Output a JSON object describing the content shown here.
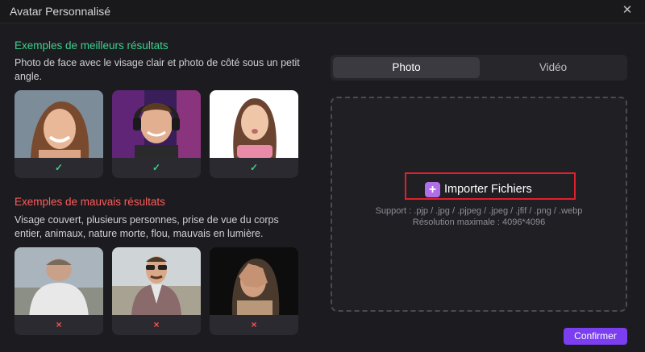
{
  "window": {
    "title": "Avatar Personnalisé"
  },
  "good": {
    "heading": "Exemples de meilleurs résultats",
    "description": "Photo de face avec le visage clair et photo de côté sous un petit angle.",
    "mark": "✓"
  },
  "bad": {
    "heading": "Exemples de mauvais résultats",
    "description": "Visage couvert, plusieurs personnes, prise de vue du corps entier, animaux, nature morte, flou, mauvais en lumière.",
    "mark": "×"
  },
  "tabs": {
    "photo": "Photo",
    "video": "Vidéo"
  },
  "upload": {
    "button": "Importer Fichiers",
    "support": "Support : .pjp / .jpg / .pjpeg / .jpeg / .jfif / .png / .webp",
    "resolution": "Résolution maximale : 4096*4096"
  },
  "footer": {
    "confirm": "Confirmer"
  },
  "colors": {
    "accent": "#7b3ff0",
    "good": "#3ecf8e",
    "bad": "#ff5a5a",
    "highlight": "#e0202a"
  }
}
